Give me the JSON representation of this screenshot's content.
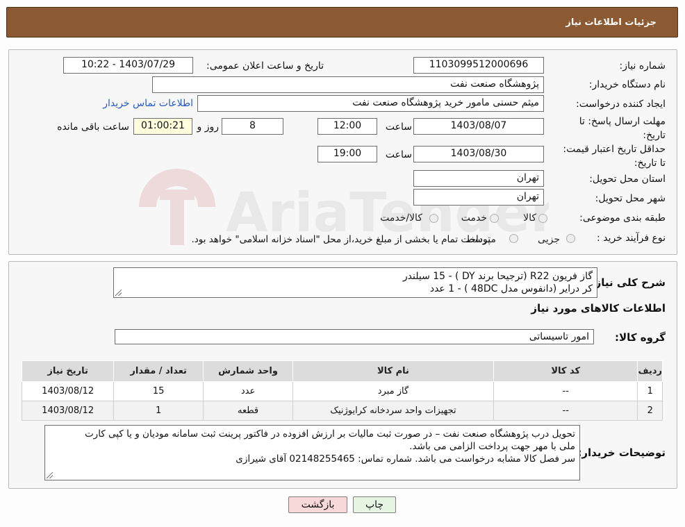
{
  "header": {
    "title": "جزئیات اطلاعات نیاز"
  },
  "form": {
    "need_number_label": "شماره نیاز:",
    "need_number": "1103099512000696",
    "announce_label": "تاریخ و ساعت اعلان عمومی:",
    "announce_value": "1403/07/29 - 10:22",
    "buyer_org_label": "نام دستگاه خریدار:",
    "buyer_org": "پژوهشگاه صنعت نفت",
    "creator_label": "ایجاد کننده درخواست:",
    "creator": "میثم حسنی مامور خرید پژوهشگاه صنعت نفت",
    "contact_link": "اطلاعات تماس خریدار",
    "deadline_label": "مهلت ارسال پاسخ: تا تاریخ:",
    "deadline_date": "1403/08/07",
    "time_label": "ساعت",
    "deadline_time": "12:00",
    "days": "8",
    "days_label": "روز و",
    "remaining": "01:00:21",
    "remaining_label": "ساعت باقی مانده",
    "validity_label": "حداقل تاریخ اعتبار قیمت: تا تاریخ:",
    "validity_date": "1403/08/30",
    "validity_time": "19:00",
    "province_label": "استان محل تحویل:",
    "province": "تهران",
    "city_label": "شهر محل تحویل:",
    "city": "تهران",
    "category_label": "طبقه بندی موضوعی:",
    "category_options": [
      "کالا",
      "خدمت",
      "کالا/خدمت"
    ],
    "process_label": "نوع فرآیند خرید :",
    "process_options": [
      "جزیی",
      "متوسط"
    ],
    "process_note": "پرداخت تمام یا بخشی از مبلغ خرید،از محل \"اسناد خزانه اسلامی\" خواهد بود."
  },
  "details": {
    "summary_label": "شرح کلی نیاز:",
    "summary_lines": [
      "گاز فریون R22 (ترجیحا برند DY ) - 15 سیلندر",
      "کر درایر (دانفوس مدل 48DC ) - 1 عدد"
    ],
    "goods_info_title": "اطلاعات کالاهای مورد نیاز",
    "group_label": "گروه کالا:",
    "group_value": "امور تاسیساتی"
  },
  "table": {
    "headers": [
      "ردیف",
      "کد کالا",
      "نام کالا",
      "واحد شمارش",
      "تعداد / مقدار",
      "تاریخ نیاز"
    ],
    "rows": [
      [
        "1",
        "--",
        "گاز مبرد",
        "عدد",
        "15",
        "1403/08/12"
      ],
      [
        "2",
        "--",
        "تجهیزات واحد سردخانه کرایوژنیک",
        "قطعه",
        "1",
        "1403/08/12"
      ]
    ]
  },
  "notes": {
    "label": "توضیحات خریدار:",
    "lines": [
      "تحویل درب پژوهشگاه صنعت نفت – در صورت ثبت مالیات بر ارزش افزوده در فاکتور پرینت ثبت سامانه مودیان و یا کپی کارت",
      "ملی با مهر جهت پرداخت الزامی می باشد.",
      "سر فصل کالا مشابه درخواست می باشد. شماره تماس: 02148255465 آقای شیرازی"
    ]
  },
  "buttons": {
    "print": "چاپ",
    "back": "بازگشت"
  },
  "watermark": {
    "text": "AriaTender.neT"
  },
  "colors": {
    "header_bg": "#8b5a32",
    "link": "#2757c8",
    "back_btn": "#f7d9d9",
    "print_btn": "#e6f5e2"
  }
}
